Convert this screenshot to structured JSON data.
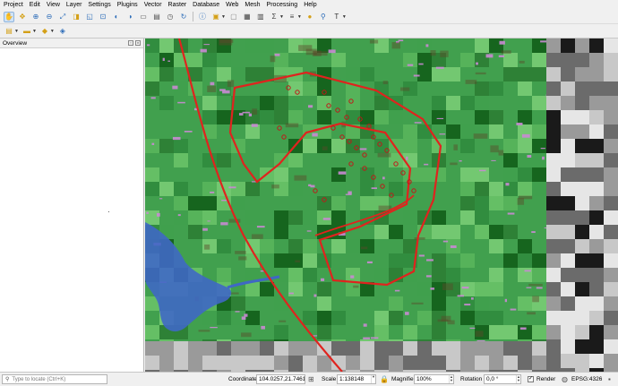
{
  "menu": {
    "items": [
      "Project",
      "Edit",
      "View",
      "Layer",
      "Settings",
      "Plugins",
      "Vector",
      "Raster",
      "Database",
      "Web",
      "Mesh",
      "Processing",
      "Help"
    ]
  },
  "toolbar": {
    "row1_icons": [
      "pan-hand-icon",
      "pan-to-selection-icon",
      "zoom-in-icon",
      "zoom-out-icon",
      "zoom-full-icon",
      "zoom-to-selection-icon",
      "zoom-to-layer-icon",
      "zoom-native-icon",
      "zoom-last-icon",
      "zoom-next-icon",
      "new-map-view-icon",
      "new-3d-view-icon",
      "temporal-controller-icon",
      "refresh-icon",
      "identify-icon",
      "select-features-icon",
      "deselect-icon",
      "attribute-table-icon",
      "field-calculator-icon",
      "statistics-icon",
      "measure-icon",
      "map-tips-icon",
      "bookmark-icon",
      "text-annotation-icon"
    ],
    "row2_icons": [
      "new-project-icon",
      "open-project-icon",
      "save-project-icon",
      "layout-manager-icon"
    ]
  },
  "overview": {
    "title": "Overview"
  },
  "status": {
    "locator_placeholder": "Type to locate (Ctrl+K)",
    "coordinate_label": "Coordinate",
    "coordinate_value": "104.0257,21.7461",
    "scale_label": "Scale",
    "scale_value": "1:138148",
    "magnifier_label": "Magnifier",
    "magnifier_value": "100%",
    "rotation_label": "Rotation",
    "rotation_value": "0,0 °",
    "render_label": "Render",
    "render_checked": true,
    "crs_label": "EPSG:4326"
  },
  "colors": {
    "map_green_base": "#41a04e",
    "map_green_light": "#6cc46a",
    "map_green_dark": "#0f5a16",
    "map_pink": "#c98ad3",
    "map_water": "#3f68c4",
    "boundary_red": "#e0231e",
    "gray_tiles": [
      "#c8c8c8",
      "#9a9a9a",
      "#6b6b6b",
      "#1a1a1a",
      "#e6e6e6"
    ]
  }
}
